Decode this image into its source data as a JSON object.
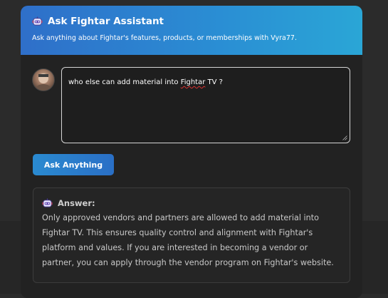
{
  "header": {
    "title": "Ask Fightar Assistant",
    "subtitle": "Ask anything about Fightar's features, products, or memberships with Vyra77."
  },
  "question": {
    "text_before": "who else can add material into ",
    "text_misspelled": "Fightar",
    "text_after": " TV ?"
  },
  "ask_button": {
    "label": "Ask Anything"
  },
  "answer": {
    "title": "Answer:",
    "body": "Only approved vendors and partners are allowed to add material into\nFightar TV. This ensures quality control and alignment with Fightar's\nplatform and values. If you are interested in becoming a vendor or\npartner, you can apply through the vendor program on Fightar's website."
  },
  "icons": {
    "header": "robot-icon",
    "answer": "robot-icon",
    "avatar": "user-avatar"
  },
  "colors": {
    "header_gradient_start": "#2f6fc9",
    "header_gradient_end": "#2aa6d6",
    "panel_bg": "#222222",
    "button_gradient_start": "#2a8ad0",
    "button_gradient_end": "#2a6fc6"
  }
}
